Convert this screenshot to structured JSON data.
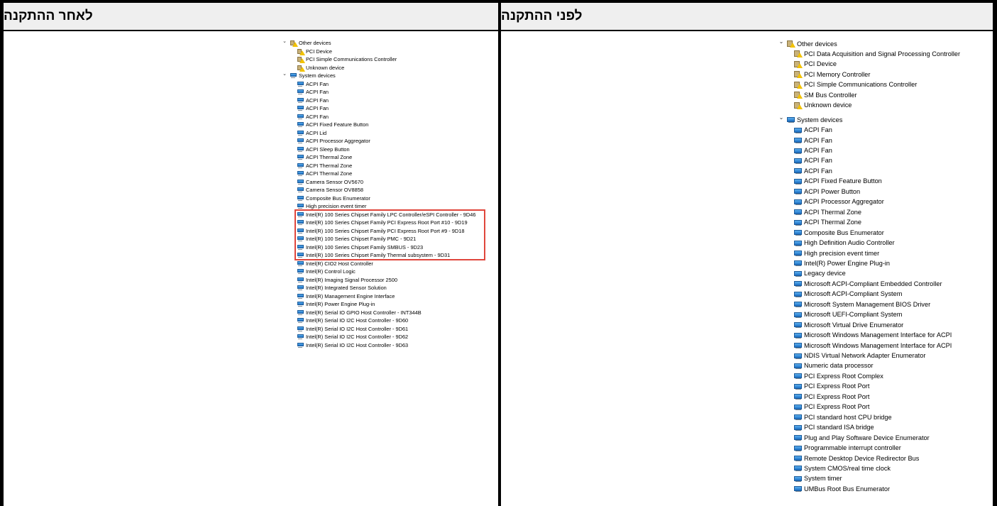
{
  "header": {
    "after_title": "לאחר ההתקנה",
    "before_title": "לפני ההתקנה"
  },
  "after": {
    "other_devices_label": "Other devices",
    "other_devices": [
      "PCI Device",
      "PCI Simple Communications Controller",
      "Unknown device"
    ],
    "system_devices_label": "System devices",
    "system_devices": [
      "ACPI Fan",
      "ACPI Fan",
      "ACPI Fan",
      "ACPI Fan",
      "ACPI Fan",
      "ACPI Fixed Feature Button",
      "ACPI Lid",
      "ACPI Processor Aggregator",
      "ACPI Sleep Button",
      "ACPI Thermal Zone",
      "ACPI Thermal Zone",
      "ACPI Thermal Zone",
      "Camera Sensor OV5670",
      "Camera Sensor OV8858",
      "Composite Bus Enumerator",
      "High precision event timer",
      "Intel(R) 100 Series Chipset Family LPC Controller/eSPI Controller - 9D46",
      "Intel(R) 100 Series Chipset Family PCI Express Root Port #10 - 9D19",
      "Intel(R) 100 Series Chipset Family PCI Express Root Port #9 - 9D18",
      "Intel(R) 100 Series Chipset Family PMC - 9D21",
      "Intel(R) 100 Series Chipset Family SMBUS - 9D23",
      "Intel(R) 100 Series Chipset Family Thermal subsystem - 9D31",
      "Intel(R) CIO2 Host Controller",
      "Intel(R) Control Logic",
      "Intel(R) Imaging Signal Processor 2500",
      "Intel(R) Integrated Sensor Solution",
      "Intel(R) Management Engine Interface",
      "Intel(R) Power Engine Plug-in",
      "Intel(R) Serial IO GPIO Host Controller - INT344B",
      "Intel(R) Serial IO I2C Host Controller - 9D60",
      "Intel(R) Serial IO I2C Host Controller - 9D61",
      "Intel(R) Serial IO I2C Host Controller - 9D62",
      "Intel(R) Serial IO I2C Host Controller - 9D63"
    ],
    "highlight_color": "#e0463c"
  },
  "before": {
    "other_devices_label": "Other devices",
    "other_devices": [
      "PCI Data Acquisition and Signal Processing Controller",
      "PCI Device",
      "PCI Memory Controller",
      "PCI Simple Communications Controller",
      "SM Bus Controller",
      "Unknown device"
    ],
    "system_devices_label": "System devices",
    "system_devices": [
      "ACPI Fan",
      "ACPI Fan",
      "ACPI Fan",
      "ACPI Fan",
      "ACPI Fan",
      "ACPI Fixed Feature Button",
      "ACPI Power Button",
      "ACPI Processor Aggregator",
      "ACPI Thermal Zone",
      "ACPI Thermal Zone",
      "Composite Bus Enumerator",
      "High Definition Audio Controller",
      "High precision event timer",
      "Intel(R) Power Engine Plug-in",
      "Legacy device",
      "Microsoft ACPI-Compliant Embedded Controller",
      "Microsoft ACPI-Compliant System",
      "Microsoft System Management BIOS Driver",
      "Microsoft UEFI-Compliant System",
      "Microsoft Virtual Drive Enumerator",
      "Microsoft Windows Management Interface for ACPI",
      "Microsoft Windows Management Interface for ACPI",
      "NDIS Virtual Network Adapter Enumerator",
      "Numeric data processor",
      "PCI Express Root Complex",
      "PCI Express Root Port",
      "PCI Express Root Port",
      "PCI Express Root Port",
      "PCI standard host CPU bridge",
      "PCI standard ISA bridge",
      "Plug and Play Software Device Enumerator",
      "Programmable interrupt controller",
      "Remote Desktop Device Redirector Bus",
      "System CMOS/real time clock",
      "System timer",
      "UMBus Root Bus Enumerator"
    ]
  }
}
